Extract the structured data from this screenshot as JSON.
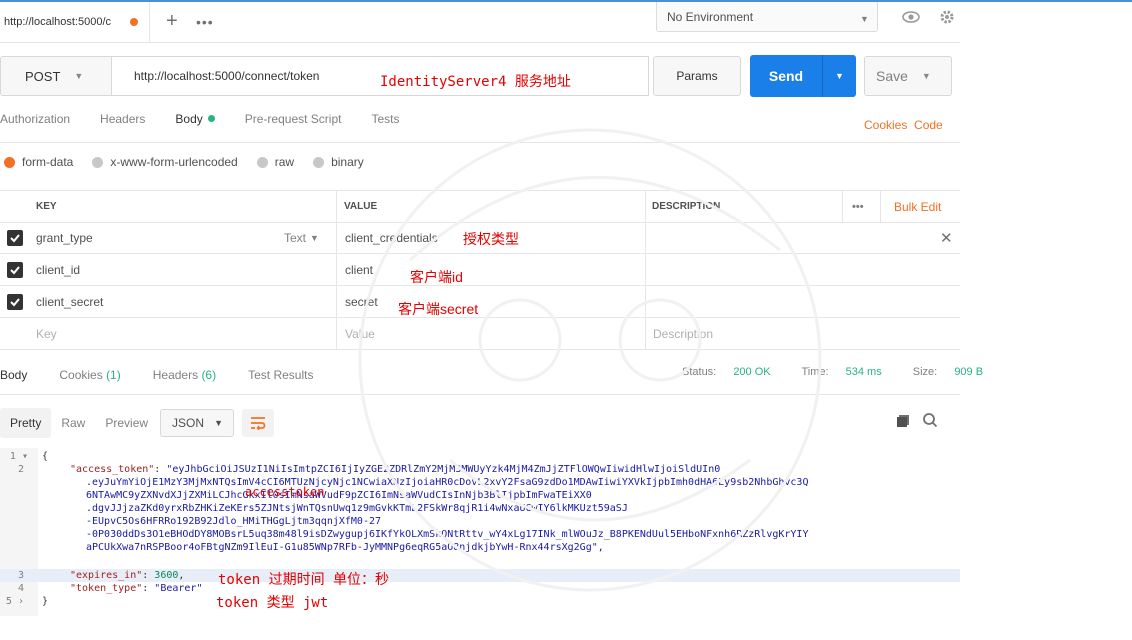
{
  "tab": {
    "url_label": "http://localhost:5000/c",
    "new_tab": "+",
    "more": "•••"
  },
  "environment": {
    "label": "No Environment"
  },
  "request": {
    "method": "POST",
    "url": "http://localhost:5000/connect/token",
    "url_annotation": "IdentityServer4 服务地址",
    "params_label": "Params",
    "send_label": "Send",
    "save_label": "Save"
  },
  "request_tabs": [
    {
      "label": "Authorization"
    },
    {
      "label": "Headers"
    },
    {
      "label": "Body"
    },
    {
      "label": "Pre-request Script"
    },
    {
      "label": "Tests"
    }
  ],
  "cookies_code": "Cookies  Code",
  "body_modes": [
    {
      "label": "form-data",
      "selected": true
    },
    {
      "label": "x-www-form-urlencoded",
      "selected": false
    },
    {
      "label": "raw",
      "selected": false
    },
    {
      "label": "binary",
      "selected": false
    }
  ],
  "kv_table": {
    "headers": {
      "key": "KEY",
      "value": "VALUE",
      "description": "DESCRIPTION",
      "more": "•••",
      "bulk_edit": "Bulk Edit"
    },
    "rows": [
      {
        "key": "grant_type",
        "type": "Text",
        "value": "client_credentials",
        "annotation": "授权类型"
      },
      {
        "key": "client_id",
        "value": "client",
        "annotation": "客户端id"
      },
      {
        "key": "client_secret",
        "value": "secret",
        "annotation": "客户端secret"
      }
    ],
    "new_row": {
      "key_placeholder": "Key",
      "value_placeholder": "Value",
      "description_placeholder": "Description"
    }
  },
  "response_tabs": [
    {
      "label": "Body"
    },
    {
      "label": "Cookies",
      "count": "(1)"
    },
    {
      "label": "Headers",
      "count": "(6)"
    },
    {
      "label": "Test Results"
    }
  ],
  "status": {
    "status_label": "Status:",
    "status_value": "200 OK",
    "time_label": "Time:",
    "time_value": "534 ms",
    "size_label": "Size:",
    "size_value": "909 B"
  },
  "view_modes": [
    "Pretty",
    "Raw",
    "Preview"
  ],
  "format": "JSON",
  "code": {
    "line_numbers": [
      "1",
      "2",
      "3",
      "4",
      "5"
    ],
    "open_brace": "{",
    "access_token_key": "\"access_token\"",
    "token_lines": [
      "\"eyJhbGciOiJSUzI1NiIsImtpZCI6IjIyZGE2ZDRlZmY2MjM3MWUyYzk4MjM4ZmJjZTFlOWQwIiwidHlwIjoiSldUIn0",
      ".eyJuYmYiOjE1MzY3MjMxNTQsImV4cCI6MTUzNjcyNjc1NCwiaXNzIjoiaHR0cDovL2xvY2FsaG9zdDo1MDAwIiwiYXVkIjpbImh0dHA6Ly9sb2NhbGhvc3Q",
      "6NTAwMC9yZXNvdXJjZXMiLCJhcGkxIl0sImNsaWVudF9pZCI6ImNsaWVudCIsInNjb3BlIjpbImFwaTEiXX0",
      ".dgvJJjzaZKd0yrxRbZHKiZeKErs5ZJNtsjWnTQsnUwq1z9mGvkKTmL2FSkWr8qjR1i4wNxaUGwIY6lkMKUzt59aSJ",
      "-EUpvC5Os6HFRRo192B92Jdlo_HMiTHGgLjtm3qqnjXfM0-27",
      "-0P030ddDs3O1eBHOdDY8MOBsrL5uq38m48l9isDZwygupj6IKfYkOLXmSkQNtRttv_wY4xLg17INk_mlWOuJz_B8PKENdUul5EHboNFxnh6RZzRlvgKrYIY",
      "aPCUkXwa7nRSPBoor4oFBtgNZm9IlEuI-G1u85WNp7RFb-JyMMNPg6eqRG5aO8njdkjbYwH-Rnx44rsXg2Gg\","
    ],
    "expires_key": "\"expires_in\"",
    "expires_value": "3600",
    "token_type_key": "\"token_type\"",
    "token_type_value": "\"Bearer\"",
    "close_brace": "}"
  },
  "annotations": {
    "access_token": "accesstoken",
    "expires": "token 过期时间 单位：秒",
    "token_type": "token 类型 jwt"
  },
  "colors": {
    "accent": "#f47023",
    "send": "#1a7fe8",
    "success": "#26b47f",
    "annotation": "#e60000"
  }
}
